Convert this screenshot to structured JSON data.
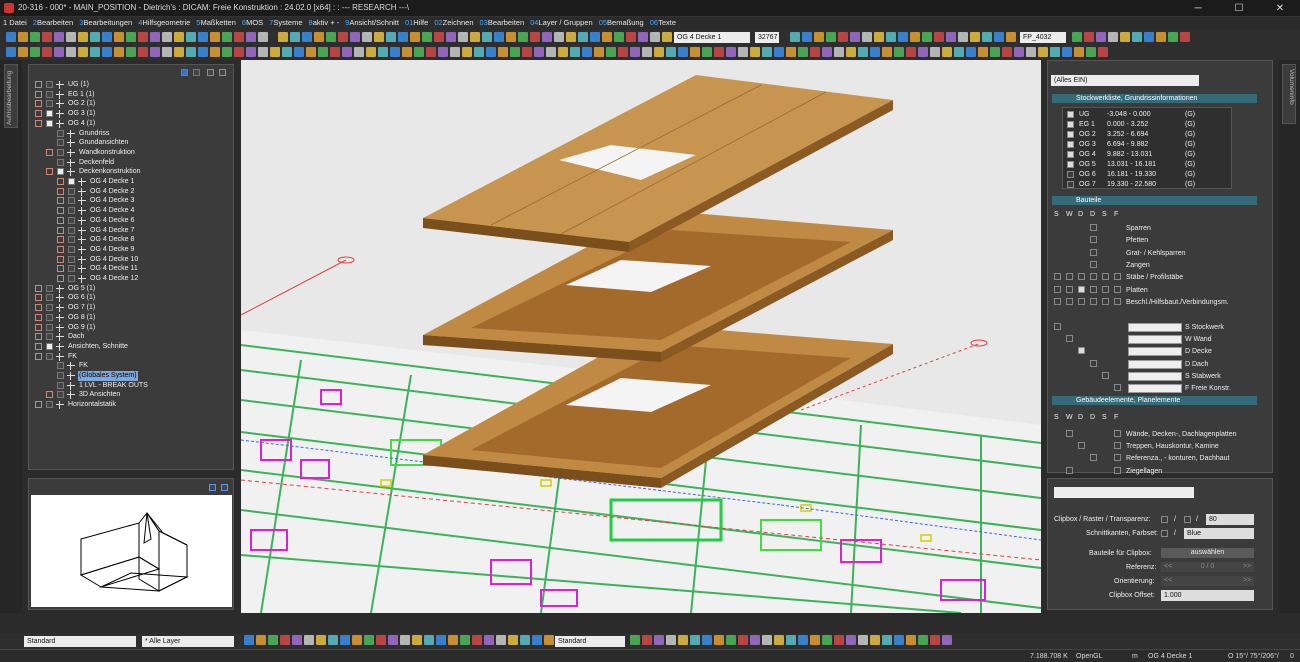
{
  "window": {
    "title": "20-316 - 000* - MAIN_POSITION - Dietrich's : DICAM: Freie Konstruktion : 24.02.0 [x64] : : --- RESEARCH ---\\",
    "min": "─",
    "max": "☐",
    "close": "✕"
  },
  "menu": [
    {
      "num": "",
      "label": "1 Datei"
    },
    {
      "num": "2",
      "label": "Bearbeiten"
    },
    {
      "num": "3",
      "label": "Bearbeitungen"
    },
    {
      "num": "4",
      "label": "Hilfsgeometrie"
    },
    {
      "num": "5",
      "label": "Maßketten"
    },
    {
      "num": "6",
      "label": "MOS"
    },
    {
      "num": "7",
      "label": "Systeme"
    },
    {
      "num": "8",
      "label": "aktiv + -"
    },
    {
      "num": "9",
      "label": "Ansicht/Schnitt"
    },
    {
      "num": "01",
      "label": "Hilfe"
    },
    {
      "num": "02",
      "label": "Zeichnen"
    },
    {
      "num": "03",
      "label": "Bearbeiten"
    },
    {
      "num": "04",
      "label": "Layer / Gruppen"
    },
    {
      "num": "05",
      "label": "Bemaßung"
    },
    {
      "num": "06",
      "label": "Texte"
    }
  ],
  "toolbar": {
    "active_element": "OG 4 Decke 1",
    "color_value": "32767",
    "position": "FP_4032"
  },
  "left_strip_label": "Aufrissbearbeitung",
  "right_strip_label": "Volumeninfo",
  "tree": [
    {
      "label": "UG (1)",
      "level": 0,
      "exp": "+",
      "check": false
    },
    {
      "label": "EG 1 (1)",
      "level": 0,
      "exp": "+",
      "check": false
    },
    {
      "label": "OG 2 (1)",
      "level": 0,
      "exp": "+",
      "check": false
    },
    {
      "label": "OG 3 (1)",
      "level": 0,
      "exp": "+",
      "check": true
    },
    {
      "label": "OG 4 (1)",
      "level": 0,
      "exp": "-",
      "check": true
    },
    {
      "label": "Grundriss",
      "level": 1,
      "exp": "",
      "check": false
    },
    {
      "label": "Grundansichten",
      "level": 1,
      "exp": "",
      "check": false
    },
    {
      "label": "Wandkonstruktion",
      "level": 1,
      "exp": "+",
      "check": false
    },
    {
      "label": "Deckenfeld",
      "level": 1,
      "exp": "",
      "check": false
    },
    {
      "label": "Deckenkonstruktion",
      "level": 1,
      "exp": "-",
      "check": true
    },
    {
      "label": "OG 4 Decke 1",
      "level": 2,
      "exp": "+",
      "check": true
    },
    {
      "label": "OG 4 Decke 2",
      "level": 2,
      "exp": "+",
      "check": false
    },
    {
      "label": "OG 4 Decke 3",
      "level": 2,
      "exp": "+",
      "check": false
    },
    {
      "label": "OG 4 Decke 4",
      "level": 2,
      "exp": "+",
      "check": false
    },
    {
      "label": "OG 4 Decke 6",
      "level": 2,
      "exp": "+",
      "check": false
    },
    {
      "label": "OG 4 Decke 7",
      "level": 2,
      "exp": "+",
      "check": false
    },
    {
      "label": "OG 4 Decke 8",
      "level": 2,
      "exp": "+",
      "check": false
    },
    {
      "label": "OG 4 Decke 9",
      "level": 2,
      "exp": "+",
      "check": false
    },
    {
      "label": "OG 4 Decke 10",
      "level": 2,
      "exp": "+",
      "check": false
    },
    {
      "label": "OG 4 Decke 11",
      "level": 2,
      "exp": "+",
      "check": false
    },
    {
      "label": "OG 4 Decke 12",
      "level": 2,
      "exp": "+",
      "check": false
    },
    {
      "label": "OG 5 (1)",
      "level": 0,
      "exp": "+",
      "check": false
    },
    {
      "label": "OG 6 (1)",
      "level": 0,
      "exp": "+",
      "check": false
    },
    {
      "label": "OG 7 (1)",
      "level": 0,
      "exp": "+",
      "check": false
    },
    {
      "label": "OG 8 (1)",
      "level": 0,
      "exp": "+",
      "check": false
    },
    {
      "label": "OG 9 (1)",
      "level": 0,
      "exp": "+",
      "check": false
    },
    {
      "label": "Dach",
      "level": 0,
      "exp": "+",
      "check": false
    },
    {
      "label": "Ansichten, Schnitte",
      "level": 0,
      "exp": "+",
      "check": true
    },
    {
      "label": "FK",
      "level": 0,
      "exp": "-",
      "check": false
    },
    {
      "label": "FK",
      "level": 1,
      "exp": "",
      "check": false
    },
    {
      "label": "(Globales System)",
      "level": 1,
      "exp": "",
      "check": false,
      "selected": true
    },
    {
      "label": "1 LVL - BREAK OUTS",
      "level": 1,
      "exp": "",
      "check": false
    },
    {
      "label": "3D Ansichten",
      "level": 1,
      "exp": "+",
      "check": false
    },
    {
      "label": "Horizontalstatik",
      "level": 0,
      "exp": "+",
      "check": false
    }
  ],
  "right": {
    "filter": "(Alles EIN)",
    "sec_stockwerk": "Stockwerkliste, Grundrissinformationen",
    "floors": [
      {
        "name": "UG",
        "range": "-3.048 -  0.000",
        "g": "(G)",
        "on": true
      },
      {
        "name": "EG 1",
        "range": "0.000  -  3.252",
        "g": "(G)",
        "on": true
      },
      {
        "name": "OG 2",
        "range": "3.252  -  6.694",
        "g": "(G)",
        "on": true
      },
      {
        "name": "OG 3",
        "range": "6.694  -  9.882",
        "g": "(G)",
        "on": true
      },
      {
        "name": "OG 4",
        "range": "9.882  - 13.031",
        "g": "(G)",
        "on": true
      },
      {
        "name": "OG 5",
        "range": "13.031 - 16.181",
        "g": "(G)",
        "on": true
      },
      {
        "name": "OG 6",
        "range": "16.181 - 19.330",
        "g": "(G)",
        "on": false
      },
      {
        "name": "OG 7",
        "range": "19.330 - 22.580",
        "g": "(G)",
        "on": false
      }
    ],
    "sec_bauteile": "Bauteile",
    "col_headers": [
      "S",
      "W",
      "D",
      "D",
      "S",
      "F"
    ],
    "bauteile": [
      {
        "label": "Sparren",
        "checked": false
      },
      {
        "label": "Pfetten",
        "checked": false
      },
      {
        "label": "Grat- / Kehlsparren",
        "checked": false
      },
      {
        "label": "Zangen",
        "checked": false
      },
      {
        "label": "Stäbe / Profilstäbe",
        "checked": false
      },
      {
        "label": "Platten",
        "checked": true
      },
      {
        "label": "Beschl./Hilfsbaut./Verbindungsm.",
        "checked": false
      }
    ],
    "types": [
      {
        "label": "S Stockwerk"
      },
      {
        "label": "W Wand"
      },
      {
        "label": "D Decke",
        "checked": true
      },
      {
        "label": "D Dach"
      },
      {
        "label": "S Stabwerk"
      },
      {
        "label": "F Freie Konstr."
      }
    ],
    "sec_gebaeude": "Gebäudeelemente, Planelemente",
    "gebaeude": [
      {
        "label": "Wände, Decken-, Dachlagenplatten"
      },
      {
        "label": "Treppen, Hauskontur, Kamine"
      },
      {
        "label": "Referenza., - konturen, Dachhaut"
      },
      {
        "label": "Ziegellagen"
      }
    ]
  },
  "clip": {
    "label_clipbox": "Clipbox / Raster / Transparenz:",
    "transparency": "80",
    "label_kanten": "Schnittkanten, Farbset:",
    "farbset": "Blue",
    "label_bauteile": "Bauteile für Clipbox:",
    "auswaehlen": "auswählen",
    "label_referenz": "Referenz:",
    "referenz": "0 / 0",
    "label_orient": "Orientierung:",
    "label_offset": "Clipbox Offset:",
    "offset": "1.000",
    "prev": "<<",
    "next": ">>"
  },
  "bottom": {
    "style": "Standard",
    "layer": "* Alle Layer",
    "style2": "Standard"
  },
  "status": {
    "memory": "7.188.708 K",
    "renderer": "OpenGL",
    "unit": "m",
    "element": "OG 4 Decke 1",
    "view": "O 15°/ 75°/206°/",
    "zoom": "0"
  },
  "colors": {
    "wood": "#b9823f",
    "plan_green": "#2f9e4f",
    "plan_magenta": "#e020d0",
    "section_head": "#356a78"
  }
}
